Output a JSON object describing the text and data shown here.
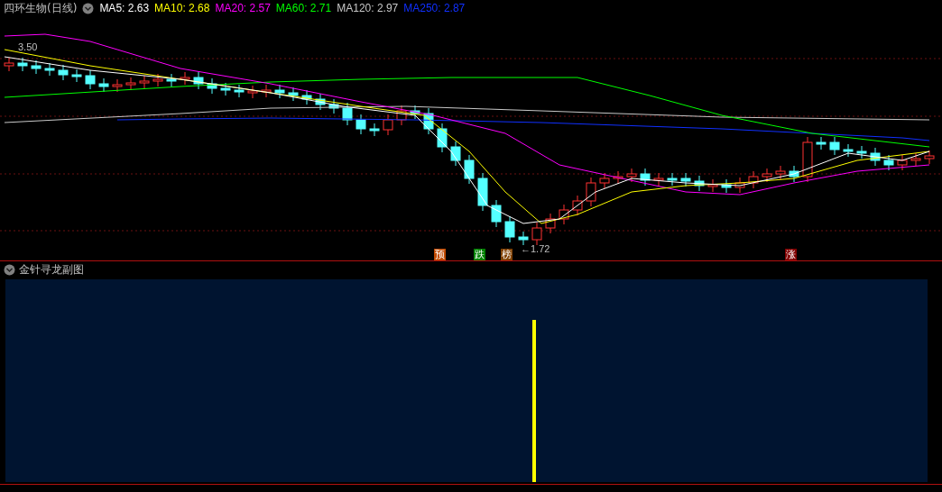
{
  "chart": {
    "title": "四环生物(日线)",
    "ma_legend": [
      {
        "label": "MA5: 2.63",
        "color": "#ffffff"
      },
      {
        "label": "MA10: 2.68",
        "color": "#ffff00"
      },
      {
        "label": "MA20: 2.57",
        "color": "#ff00ff"
      },
      {
        "label": "MA60: 2.71",
        "color": "#00ff00"
      },
      {
        "label": "MA120: 2.97",
        "color": "#c8c8c8"
      },
      {
        "label": "MA250: 2.87",
        "color": "#1030ff"
      }
    ],
    "high_label": "3.50",
    "low_label": "←1.72",
    "markers": [
      {
        "text": "预",
        "color": "#c04a00"
      },
      {
        "text": "跌",
        "color": "#008000"
      },
      {
        "text": "榜",
        "color": "#804000"
      },
      {
        "text": "涨",
        "color": "#800000"
      }
    ]
  },
  "sub_chart": {
    "title": "金针寻龙副图"
  }
}
